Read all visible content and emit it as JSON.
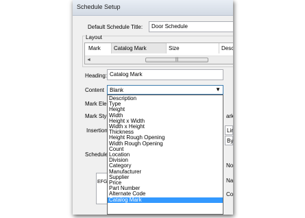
{
  "window": {
    "title": "Schedule Setup"
  },
  "schedule_title": {
    "label": "Default Schedule Title:",
    "value": "Door Schedule"
  },
  "layout": {
    "label": "Layout",
    "columns": [
      "Mark",
      "Catalog Mark",
      "Size",
      "Desc"
    ],
    "scroll_left": "◄",
    "thumb_grip": "|||"
  },
  "heading": {
    "label": "Heading:",
    "value": "Catalog Mark"
  },
  "content": {
    "label": "Content",
    "selected": "Blank",
    "arrow": "▼",
    "options": [
      "Description",
      "Type",
      "Height",
      "Width",
      "Height x Width",
      "Width x Height",
      "Thickness",
      "Height Rough Opening",
      "Width Rough Opening",
      "Count",
      "Location",
      "Division",
      "Category",
      "Manufacturer",
      "Supplier",
      "Price",
      "Part Number",
      "Alternate Code",
      "Catalog Mark"
    ],
    "highlighted_option": "Catalog Mark"
  },
  "behind": {
    "mark_elem": "Mark Elem",
    "mark_styl": "Mark Styl",
    "insertion": "Insertion",
    "schedule": "Schedule",
    "efg": "EFG",
    "right_ark": "ark",
    "right_lin": "Lin",
    "right_by": "By",
    "right_note": "Note",
    "right_name": "Name",
    "right_comm": "Comm"
  }
}
